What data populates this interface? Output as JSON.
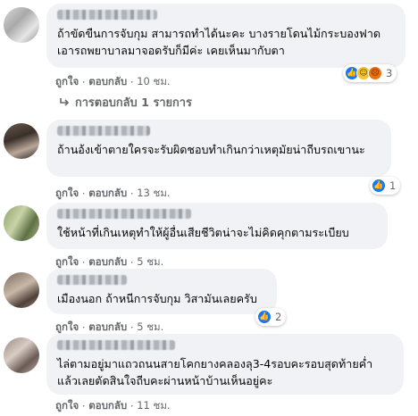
{
  "actions": {
    "like": "ถูกใจ",
    "reply": "ตอบกลับ",
    "dot": "·"
  },
  "comments": [
    {
      "text": "ถ้าขัดขืนการจับกุม สามารถทำได้นะคะ บางรายโดนไม้กระบองฟาดเอารถพยาบาลมาจอดรับก็มีค่ะ เคยเห็นมากับตา",
      "time": "10 ชม.",
      "reactions": {
        "icons": [
          "like-icon",
          "haha-icon",
          "angry-icon"
        ],
        "count": "3"
      },
      "replies_label": "การตอบกลับ 1 รายการ"
    },
    {
      "text": "ถ้านอ้งเข้าตายใครจะรับผิดชอบทำเกินกว่าเหตุมัยน่าถีบรถเขานะ",
      "time": "13 ชม.",
      "reactions": {
        "icons": [
          "like-icon"
        ],
        "count": "1"
      }
    },
    {
      "text": "ใช้หน้าที่เกินเหตุทำให้ผู้อื่นเสียชีวิตน่าจะไม่คิดคุกตามระเบียบ",
      "time": "5 ชม."
    },
    {
      "text": "เมืองนอก ถ้าหนีการจับกุม วิสามันเลยครับ",
      "time": "5 ชม.",
      "reactions": {
        "icons": [
          "like-icon"
        ],
        "count": "2"
      }
    },
    {
      "text": "ไล่ตามอยู่มาแถวถนนสายโคกยางคลองลุ3-4รอบคะรอบสุดท้ายค่ำแล้วเลยตัดสินใจถีบคะผ่านหน้าบ้านเห็นอยู่คะ",
      "time": "11 ชม."
    }
  ],
  "colors": {
    "bubble": "#f0f2f5",
    "meta": "#65676b",
    "like": "#1877f2"
  }
}
